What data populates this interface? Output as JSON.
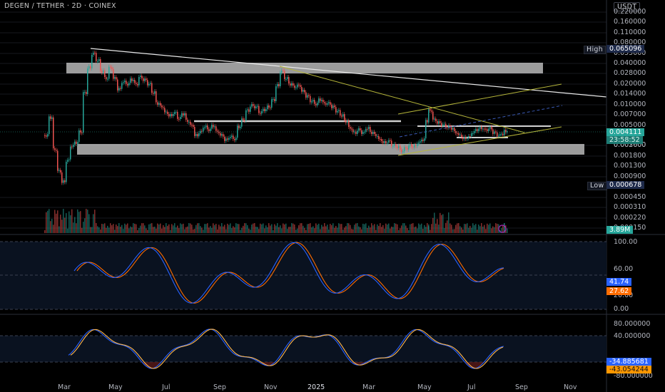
{
  "header": {
    "symbol": "DEGEN / TETHER · 2D · COINEX",
    "currency": "USDT"
  },
  "price_axis": [
    "0.220000",
    "0.160000",
    "0.110000",
    "0.080000",
    "0.055000",
    "0.040000",
    "0.028000",
    "0.020000",
    "0.014000",
    "0.010000",
    "0.007000",
    "0.005000",
    "0.003600",
    "0.002600",
    "0.001800",
    "0.001300",
    "0.000900",
    "0.000450",
    "0.000310",
    "0.000220",
    "0.000150"
  ],
  "tags": {
    "high_label": "High",
    "high_value": "0.065096",
    "low_label": "Low",
    "low_value": "0.000678",
    "last_price": "0.004111",
    "countdown": "23:58:52",
    "volume": "3.89M"
  },
  "stoch_rsi": {
    "axis": [
      "100.00",
      "60.00",
      "20.00",
      "0.00"
    ],
    "k": "41.74",
    "d": "27.62"
  },
  "oscillator": {
    "axis": [
      "80.000000",
      "40.000000",
      "-80.000000"
    ],
    "v1": "-34.885681",
    "v2": "-43.054244"
  },
  "time_axis": [
    "Mar",
    "May",
    "Jul",
    "Sep",
    "Nov",
    "2025",
    "Mar",
    "May",
    "Jul",
    "Sep",
    "Nov"
  ],
  "colors": {
    "up": "#26a69a",
    "down": "#ef5350",
    "stoch_k": "#2962ff",
    "stoch_d": "#ff6d00",
    "trend": "#e8e8e8",
    "channel": "#b5b53a",
    "zone": "#d8d8d8"
  }
}
